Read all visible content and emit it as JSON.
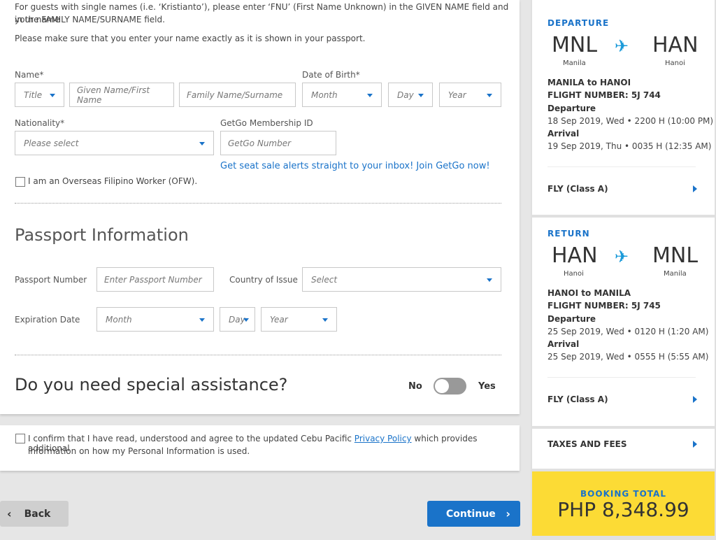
{
  "notes": {
    "single_name_line1": "For guests with single names (i.e. ‘Kristianto’), please enter ‘FNU’ (First Name Unknown) in the GIVEN NAME field and your name",
    "single_name_line2": "in the FAMILY NAME/SURNAME field.",
    "exact_name": "Please make sure that you enter your name exactly as it is shown in your passport."
  },
  "guest": {
    "name_label": "Name*",
    "dob_label": "Date of Birth*",
    "title_placeholder": "Title",
    "given_name_placeholder": "Given Name/First Name",
    "family_name_placeholder": "Family Name/Surname",
    "month_placeholder": "Month",
    "day_placeholder": "Day",
    "year_placeholder": "Year",
    "nationality_label": "Nationality*",
    "nationality_placeholder": "Please select",
    "getgo_label": "GetGo Membership ID",
    "getgo_placeholder": "GetGo Number",
    "getgo_link": "Get seat sale alerts straight to your inbox! Join GetGo now!",
    "ofw_label": "I am an Overseas Filipino Worker (OFW)."
  },
  "passport": {
    "heading": "Passport Information",
    "number_label": "Passport Number",
    "number_placeholder": "Enter Passport Number",
    "country_label": "Country of Issue",
    "country_placeholder": "Select",
    "expiry_label": "Expiration Date",
    "month_placeholder": "Month",
    "day_placeholder": "Day",
    "year_placeholder": "Year"
  },
  "assistance": {
    "question": "Do you need special assistance?",
    "no_label": "No",
    "yes_label": "Yes"
  },
  "consent": {
    "text_before": "I confirm that I have read, understood and agree to the updated Cebu Pacific ",
    "link": "Privacy Policy",
    "text_after": " which provides additional",
    "line2": "information on how my Personal Information is used."
  },
  "buttons": {
    "back": "Back",
    "continue": "Continue"
  },
  "departure": {
    "tag": "DEPARTURE",
    "from_code": "MNL",
    "from_city": "Manila",
    "to_code": "HAN",
    "to_city": "Hanoi",
    "route": "MANILA to HANOI",
    "flight_number": "FLIGHT NUMBER: 5J 744",
    "dep_label": "Departure",
    "dep_time": "18 Sep 2019, Wed • 2200 H (10:00 PM)",
    "arr_label": "Arrival",
    "arr_time": "19 Sep 2019, Thu • 0035 H (12:35 AM)",
    "fare": "FLY (Class A)"
  },
  "return": {
    "tag": "RETURN",
    "from_code": "HAN",
    "from_city": "Hanoi",
    "to_code": "MNL",
    "to_city": "Manila",
    "route": "HANOI to MANILA",
    "flight_number": "FLIGHT NUMBER: 5J 745",
    "dep_label": "Departure",
    "dep_time": "25 Sep 2019, Wed • 0120 H (1:20 AM)",
    "arr_label": "Arrival",
    "arr_time": "25 Sep 2019, Wed • 0555 H (5:55 AM)",
    "fare": "FLY (Class A)"
  },
  "taxes": "TAXES AND FEES",
  "total": {
    "label": "BOOKING TOTAL",
    "amount": "PHP 8,348.99"
  },
  "colors": {
    "accent": "#1a73c9",
    "total_bg": "#fcdb35",
    "plane": "#1a9ad9"
  },
  "icons": {
    "plane": "airplane-icon",
    "caret": "caret-down-icon",
    "chevron": "chevron-right-icon"
  },
  "toggle_state": "off"
}
